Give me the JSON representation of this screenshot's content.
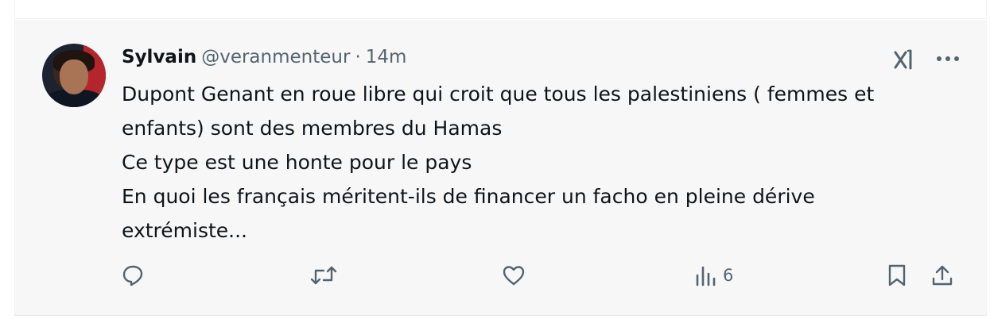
{
  "post": {
    "author_name": "Sylvain",
    "handle": "@veranmenteur",
    "separator": "·",
    "time": "14m",
    "text_lines": [
      "Dupont Genant en roue libre qui croit que tous les palestiniens ( femmes et",
      "enfants) sont des membres du Hamas",
      "Ce type est une honte pour le pays",
      "En quoi les français méritent-ils de financer un facho en pleine dérive",
      "extrémiste..."
    ],
    "views_count": "6"
  },
  "icons": {
    "grok": "grok-icon",
    "more": "more-horizontal-icon",
    "reply": "reply-icon",
    "repost": "repost-icon",
    "like": "like-icon",
    "views": "views-icon",
    "bookmark": "bookmark-icon",
    "share": "share-icon"
  },
  "colors": {
    "text_primary": "#0f1419",
    "text_secondary": "#536471",
    "background": "#f7f7f7"
  }
}
